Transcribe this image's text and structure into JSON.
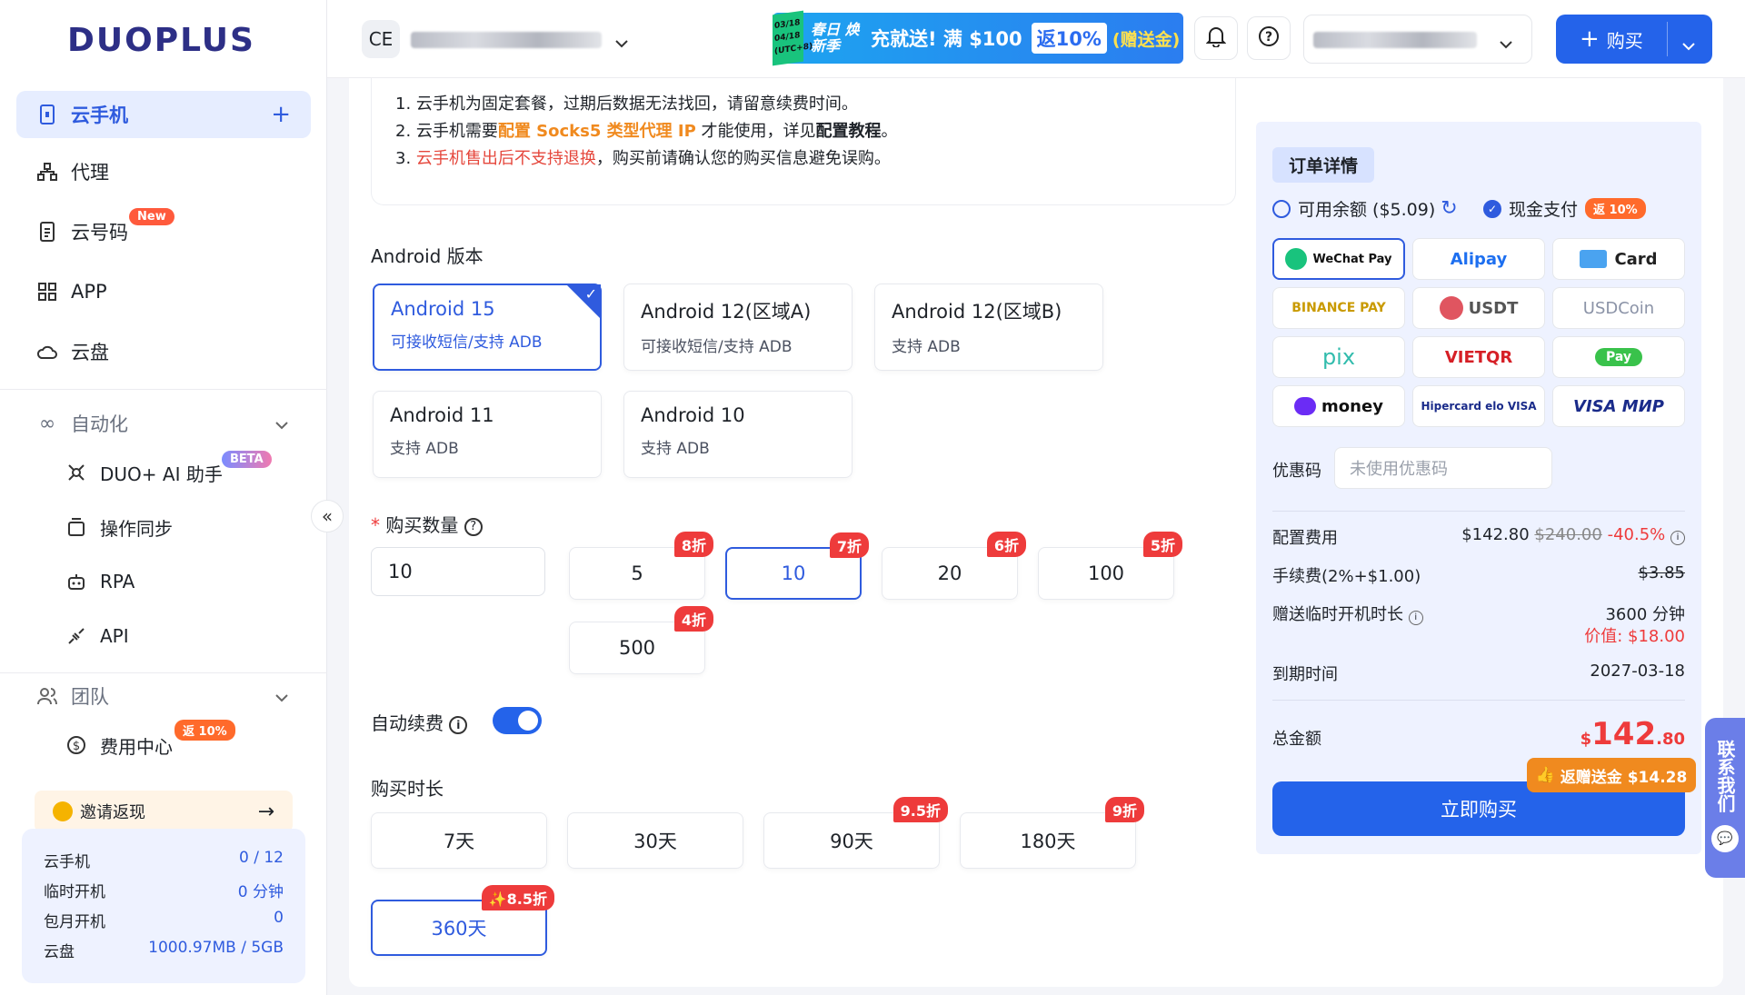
{
  "brand": {
    "logo": "DUOPLUS"
  },
  "sidebar": {
    "items": [
      {
        "label": "云手机",
        "icon": "phone-icon"
      },
      {
        "label": "代理",
        "icon": "network-icon"
      },
      {
        "label": "云号码",
        "icon": "sim-icon",
        "badge": "New"
      },
      {
        "label": "APP",
        "icon": "grid-icon"
      },
      {
        "label": "云盘",
        "icon": "cloud-icon"
      }
    ],
    "automation": {
      "label": "自动化",
      "items": [
        {
          "label": "DUO+ AI 助手",
          "badge": "BETA"
        },
        {
          "label": "操作同步"
        },
        {
          "label": "RPA"
        },
        {
          "label": "API"
        }
      ]
    },
    "team": {
      "label": "团队",
      "items": [
        {
          "label": "费用中心",
          "badge": "返 10%"
        }
      ]
    },
    "invite": {
      "label": "邀请返现"
    },
    "stats": [
      {
        "label": "云手机",
        "value": "0 / 12"
      },
      {
        "label": "临时开机",
        "value": "0 分钟"
      },
      {
        "label": "包月开机",
        "value": "0"
      },
      {
        "label": "云盘",
        "value": "1000.97MB / 5GB"
      }
    ]
  },
  "header": {
    "team_initials": "CE",
    "promo": {
      "dates": "03/18 04/18 (UTC+8)",
      "left": "春日 焕新季",
      "main": "充就送! 满 $100",
      "mid": "返10%",
      "right": "(赠送金)"
    },
    "buy_label": "购买"
  },
  "notice": {
    "l1": "1. 云手机为固定套餐，过期后数据无法找回，请留意续费时间。",
    "l2a": "2. 云手机需要",
    "l2b": "配置 Socks5 类型代理 IP",
    "l2c": " 才能使用，详见",
    "l2d": "配置教程",
    "l2e": "。",
    "l3a": "3. ",
    "l3b": "云手机售出后不支持退换",
    "l3c": "，购买前请确认您的购买信息避免误购。"
  },
  "android": {
    "title": "Android 版本",
    "versions": [
      {
        "name": "Android 15",
        "desc": "可接收短信/支持 ADB"
      },
      {
        "name": "Android 12(区域A)",
        "desc": "可接收短信/支持 ADB"
      },
      {
        "name": "Android 12(区域B)",
        "desc": "支持 ADB"
      },
      {
        "name": "Android 11",
        "desc": "支持 ADB"
      },
      {
        "name": "Android 10",
        "desc": "支持 ADB"
      }
    ],
    "selected": "Android 15"
  },
  "quantity": {
    "title": "购买数量",
    "value": "10",
    "options": [
      {
        "value": "5",
        "discount": "8折"
      },
      {
        "value": "10",
        "discount": "7折"
      },
      {
        "value": "20",
        "discount": "6折"
      },
      {
        "value": "100",
        "discount": "5折"
      },
      {
        "value": "500",
        "discount": "4折"
      }
    ],
    "selected": "10"
  },
  "auto_renew": {
    "label": "自动续费",
    "on": true
  },
  "duration": {
    "title": "购买时长",
    "options": [
      {
        "value": "7天",
        "discount": ""
      },
      {
        "value": "30天",
        "discount": ""
      },
      {
        "value": "90天",
        "discount": "9.5折"
      },
      {
        "value": "180天",
        "discount": "9折"
      },
      {
        "value": "360天",
        "discount": "✨8.5折"
      }
    ],
    "selected": "360天"
  },
  "order": {
    "title": "订单详情",
    "balance_label": "可用余额 ($5.09)",
    "cash_label": "现金支付",
    "cash_badge": "返 10%",
    "payments": [
      "WeChat Pay",
      "Alipay",
      "Card",
      "BINANCE PAY",
      "USDT",
      "USDCoin",
      "pix",
      "VIETQR",
      "Pay",
      "money",
      "Hipercard elo VISA",
      "VISA МИР"
    ],
    "coupon_label": "优惠码",
    "coupon_placeholder": "未使用优惠码",
    "config_label": "配置费用",
    "config_price": "$142.80",
    "config_orig": "$240.00",
    "config_off": "-40.5%",
    "fee_label": "手续费(2%+$1.00)",
    "fee_value": "$3.85",
    "gift_label": "赠送临时开机时长",
    "gift_value": "3600 分钟",
    "gift_worth": "价值: $18.00",
    "expire_label": "到期时间",
    "expire_value": "2027-03-18",
    "total_label": "总金额",
    "total_currency": "$",
    "total_int": "142",
    "total_dec": ".80",
    "cashback": "返赠送金 $14.28",
    "buy_now": "立即购买"
  },
  "contact": {
    "label": "联系我们"
  },
  "colors": {
    "primary": "#2463ea",
    "danger": "#ee3b3b",
    "warning": "#f08a1f"
  }
}
